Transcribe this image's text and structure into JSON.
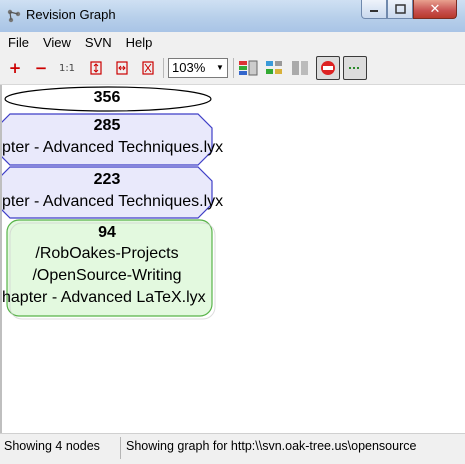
{
  "window": {
    "title": "Revision Graph"
  },
  "menu": [
    "File",
    "View",
    "SVN",
    "Help"
  ],
  "toolbar": {
    "zoom_in_label": "+",
    "zoom_out_label": "−",
    "zoom_100_label": "1:1",
    "zoom_value": "103%"
  },
  "nodes": [
    {
      "revision": "356",
      "lines": []
    },
    {
      "revision": "285",
      "lines": [
        "pter - Advanced Techniques.lyx"
      ]
    },
    {
      "revision": "223",
      "lines": [
        "pter - Advanced Techniques.lyx"
      ]
    },
    {
      "revision": "94",
      "lines": [
        "/RobOakes-Projects",
        "/OpenSource-Writing",
        "hapter - Advanced LaTeX.lyx"
      ]
    }
  ],
  "status": {
    "node_count": "Showing 4 nodes",
    "graph_for": "Showing graph for http:\\\\svn.oak-tree.us\\opensource"
  },
  "colors": {
    "deleted_fill": "#e9e9fb",
    "deleted_stroke": "#3f3fc7",
    "added_fill": "#e3f9df",
    "added_stroke": "#58b349"
  }
}
